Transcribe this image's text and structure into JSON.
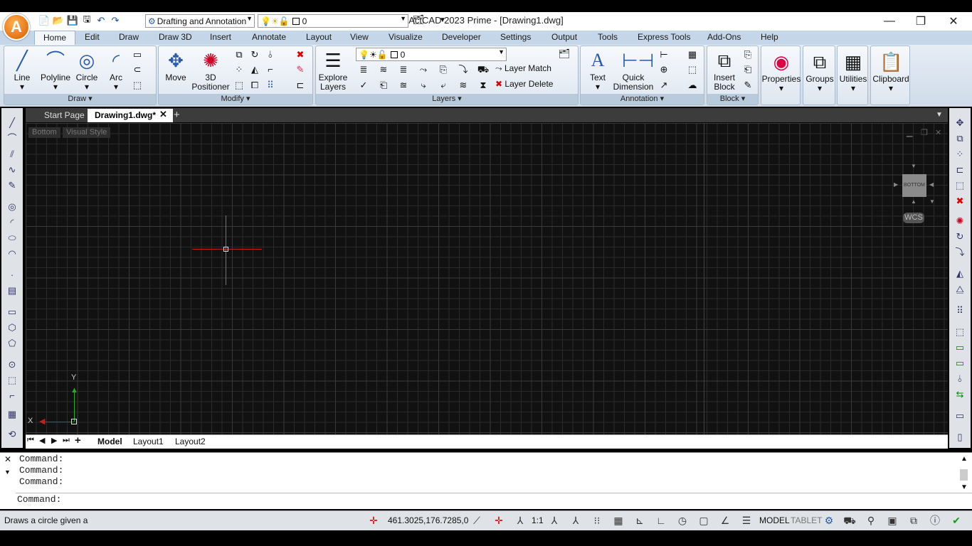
{
  "title_bar": {
    "title": "ActCAD 2023 Prime - [Drawing1.dwg]",
    "workspace": "Drafting and Annotation",
    "layer_value": "0"
  },
  "menus": [
    "Home",
    "Edit",
    "Draw",
    "Draw 3D",
    "Insert",
    "Annotate",
    "Layout",
    "View",
    "Visualize",
    "Developer",
    "Settings",
    "Output",
    "Tools",
    "Express Tools",
    "Add-Ons",
    "Help"
  ],
  "ribbon": {
    "draw": {
      "title": "Draw",
      "line": "Line",
      "polyline": "Polyline",
      "circle": "Circle",
      "arc": "Arc"
    },
    "modify": {
      "title": "Modify",
      "move": "Move",
      "positioner": "3D Positioner"
    },
    "layers": {
      "title": "Layers",
      "explore": "Explore Layers",
      "layer_value": "0",
      "layer_match": "Layer Match",
      "layer_delete": "Layer Delete"
    },
    "annotation": {
      "title": "Annotation",
      "text": "Text",
      "quick_dimension": "Quick Dimension"
    },
    "block": {
      "title": "Block",
      "insert_block": "Insert Block"
    },
    "properties": "Properties",
    "groups": "Groups",
    "utilities": "Utilities",
    "clipboard": "Clipboard"
  },
  "doc_tabs": {
    "start": "Start Page",
    "drawing": "Drawing1.dwg*"
  },
  "viewport": {
    "view_label": "Bottom",
    "style_label": "Visual Style",
    "viewcube": "BOTTOM",
    "wcs": "WCS",
    "ucs_x": "X",
    "ucs_y": "Y"
  },
  "layout_tabs": [
    "Model",
    "Layout1",
    "Layout2"
  ],
  "command": {
    "history": [
      "Command:",
      "Command:",
      "Command:"
    ],
    "prompt": "Command:"
  },
  "status": {
    "hint": "Draws a circle given a",
    "coords": "461.3025,176.7285,0",
    "scale": "1:1",
    "model": "MODEL",
    "tablet": "TABLET"
  }
}
